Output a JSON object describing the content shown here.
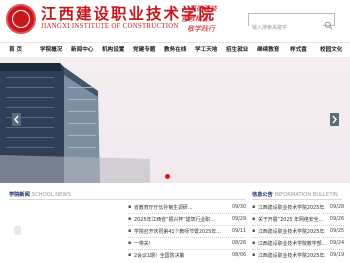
{
  "header": {
    "logo_cn": "江西建设职业技术学院",
    "logo_en": "JIANGXI INSTITUTE OF CONSTRUCTION",
    "motto": [
      "厚德强技",
      "善教精业",
      "敬学践行"
    ],
    "search_placeholder": "输入搜索关键字"
  },
  "nav": [
    "首 页",
    "学院概况",
    "新闻中心",
    "机构设置",
    "党建专题",
    "教务在线",
    "学工天地",
    "招生就业",
    "继续教育",
    "样式盘",
    "校园文化"
  ],
  "colors": {
    "brand_red": "#c8161d",
    "navy": "#1a2b6b",
    "arrow": "#5b6b77"
  },
  "news": {
    "title": "学院新闻",
    "subtitle": "SCHOOL NEWS",
    "items": [
      {
        "title": "省教育厅厅长孙菊生调研...",
        "date": "09/30"
      },
      {
        "title": "2025年江西省“振兴杯”建筑行业职...",
        "date": "09/29"
      },
      {
        "title": "学院召开庆祝第41个教师节暨2025年...",
        "date": "09/11"
      },
      {
        "title": "一带关！",
        "date": "08/26"
      },
      {
        "title": "2会议1期！全国防决策",
        "date": "08/06"
      }
    ]
  },
  "notice": {
    "title": "信息公告",
    "subtitle": "INFORMATION BULLETIN",
    "items": [
      {
        "title": "江西建设职业技术学院2025年...",
        "date": "09/28"
      },
      {
        "title": "关于开展“2025 年网络安全...",
        "date": "09/26"
      },
      {
        "title": "江西建设职业技术学院2025年...",
        "date": "09/25"
      },
      {
        "title": "江西建设职业技术学院教学部...",
        "date": "09/24"
      },
      {
        "title": "江西建设职业技术学院2025年...",
        "date": "09/19"
      }
    ]
  }
}
